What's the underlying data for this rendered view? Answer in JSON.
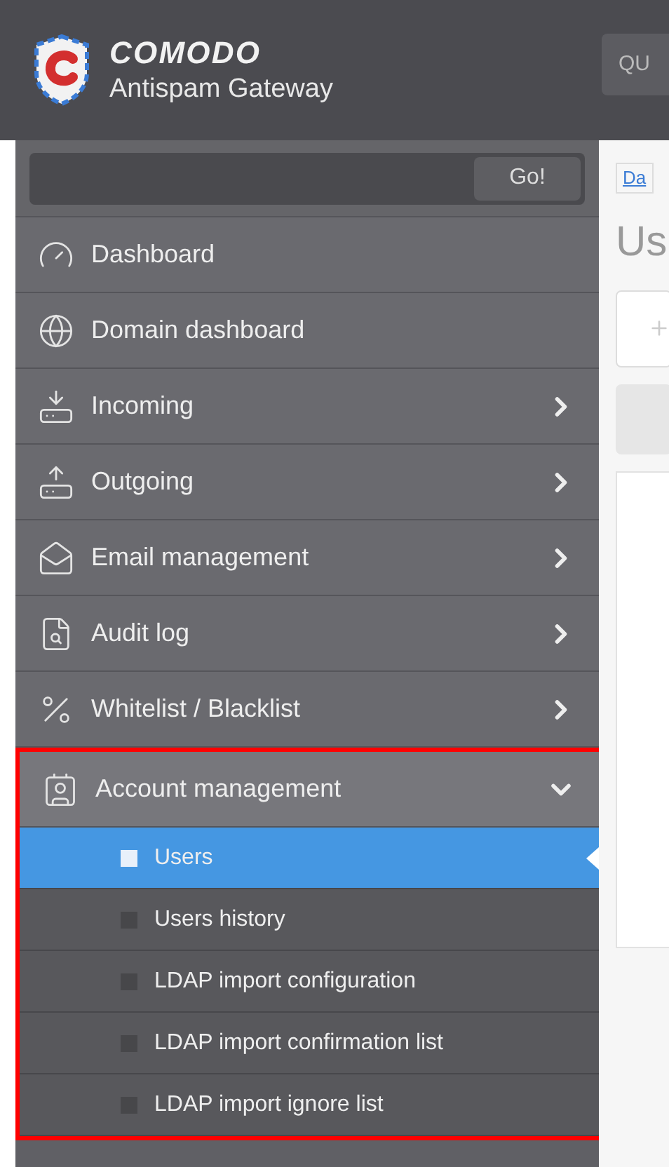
{
  "header": {
    "brand": "COMODO",
    "product": "Antispam Gateway",
    "button": "QU"
  },
  "search": {
    "button": "Go!"
  },
  "menu": [
    {
      "label": "Dashboard",
      "kind": "plain"
    },
    {
      "label": "Domain dashboard",
      "kind": "plain"
    },
    {
      "label": "Incoming",
      "kind": "group",
      "expanded": false
    },
    {
      "label": "Outgoing",
      "kind": "group",
      "expanded": false
    },
    {
      "label": "Email management",
      "kind": "group",
      "expanded": false
    },
    {
      "label": "Audit log",
      "kind": "group",
      "expanded": false
    },
    {
      "label": "Whitelist / Blacklist",
      "kind": "group",
      "expanded": false
    },
    {
      "label": "Account management",
      "kind": "group",
      "expanded": true,
      "highlighted": true,
      "children": [
        {
          "label": "Users",
          "selected": true
        },
        {
          "label": "Users history",
          "selected": false
        },
        {
          "label": "LDAP import configuration",
          "selected": false
        },
        {
          "label": "LDAP import confirmation list",
          "selected": false
        },
        {
          "label": "LDAP import ignore list",
          "selected": false
        }
      ]
    }
  ],
  "content": {
    "breadcrumb": "Da",
    "title": "Us"
  }
}
